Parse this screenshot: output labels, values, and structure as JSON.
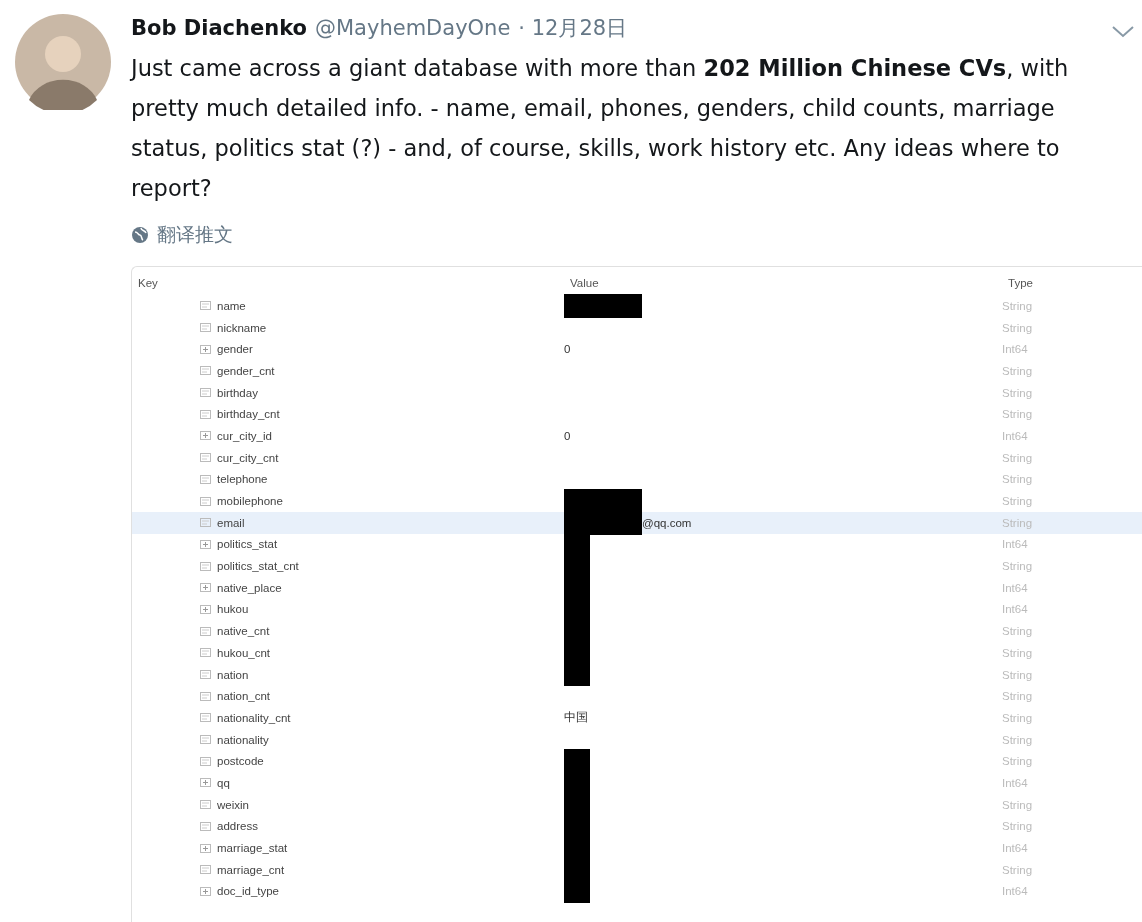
{
  "tweet": {
    "author": "Bob Diachenko",
    "handle": "@MayhemDayOne",
    "date": "· 12月28日",
    "text": "Just came across a giant database with more than **202 Million Chinese CVs**, with pretty much detailed info. - name, email, phones, genders, child counts, marriage status, politics stat (?) - and, of course, skills, work history etc. Any ideas where to report?",
    "translate": "翻译推文"
  },
  "table": {
    "columns": [
      "Key",
      "Value",
      "Type"
    ],
    "rows": [
      {
        "kind": "string",
        "key": "name",
        "value": "",
        "type": "String",
        "redacted": true,
        "wide_redaction": true,
        "selected": false
      },
      {
        "kind": "string",
        "key": "nickname",
        "value": "",
        "type": "String",
        "redacted": false,
        "selected": false
      },
      {
        "kind": "int",
        "key": "gender",
        "value": "0",
        "type": "Int64",
        "redacted": false,
        "selected": false
      },
      {
        "kind": "string",
        "key": "gender_cnt",
        "value": "",
        "type": "String",
        "redacted": false,
        "selected": false
      },
      {
        "kind": "string",
        "key": "birthday",
        "value": "",
        "type": "String",
        "redacted": false,
        "selected": false
      },
      {
        "kind": "string",
        "key": "birthday_cnt",
        "value": "",
        "type": "String",
        "redacted": false,
        "selected": false
      },
      {
        "kind": "int",
        "key": "cur_city_id",
        "value": "0",
        "type": "Int64",
        "redacted": false,
        "selected": false
      },
      {
        "kind": "string",
        "key": "cur_city_cnt",
        "value": "",
        "type": "String",
        "redacted": false,
        "selected": false
      },
      {
        "kind": "string",
        "key": "telephone",
        "value": "",
        "type": "String",
        "redacted": false,
        "selected": false
      },
      {
        "kind": "string",
        "key": "mobilephone",
        "value": "",
        "type": "String",
        "redacted": true,
        "wide_redaction": true,
        "selected": false
      },
      {
        "kind": "string",
        "key": "email",
        "value": "@qq.com",
        "type": "String",
        "redacted": true,
        "wide_redaction": true,
        "selected": true
      },
      {
        "kind": "int",
        "key": "politics_stat",
        "value": "",
        "type": "Int64",
        "redacted": true,
        "wide_redaction": false,
        "selected": false
      },
      {
        "kind": "string",
        "key": "politics_stat_cnt",
        "value": "",
        "type": "String",
        "redacted": true,
        "wide_redaction": false,
        "selected": false
      },
      {
        "kind": "int",
        "key": "native_place",
        "value": "",
        "type": "Int64",
        "redacted": true,
        "wide_redaction": false,
        "selected": false
      },
      {
        "kind": "int",
        "key": "hukou",
        "value": "",
        "type": "Int64",
        "redacted": true,
        "wide_redaction": false,
        "selected": false
      },
      {
        "kind": "string",
        "key": "native_cnt",
        "value": "",
        "type": "String",
        "redacted": true,
        "wide_redaction": false,
        "selected": false
      },
      {
        "kind": "string",
        "key": "hukou_cnt",
        "value": "",
        "type": "String",
        "redacted": true,
        "wide_redaction": false,
        "selected": false
      },
      {
        "kind": "string",
        "key": "nation",
        "value": "",
        "type": "String",
        "redacted": true,
        "wide_redaction": false,
        "selected": false
      },
      {
        "kind": "string",
        "key": "nation_cnt",
        "value": "",
        "type": "String",
        "redacted": false,
        "selected": false
      },
      {
        "kind": "string",
        "key": "nationality_cnt",
        "value": "中国",
        "type": "String",
        "redacted": false,
        "selected": false
      },
      {
        "kind": "string",
        "key": "nationality",
        "value": "",
        "type": "String",
        "redacted": false,
        "selected": false
      },
      {
        "kind": "string",
        "key": "postcode",
        "value": "",
        "type": "String",
        "redacted": true,
        "wide_redaction": false,
        "selected": false
      },
      {
        "kind": "int",
        "key": "qq",
        "value": "",
        "type": "Int64",
        "redacted": true,
        "wide_redaction": false,
        "selected": false
      },
      {
        "kind": "string",
        "key": "weixin",
        "value": "",
        "type": "String",
        "redacted": true,
        "wide_redaction": false,
        "selected": false
      },
      {
        "kind": "string",
        "key": "address",
        "value": "",
        "type": "String",
        "redacted": true,
        "wide_redaction": false,
        "selected": false
      },
      {
        "kind": "int",
        "key": "marriage_stat",
        "value": "",
        "type": "Int64",
        "redacted": true,
        "wide_redaction": false,
        "selected": false
      },
      {
        "kind": "string",
        "key": "marriage_cnt",
        "value": "",
        "type": "String",
        "redacted": true,
        "wide_redaction": false,
        "selected": false
      },
      {
        "kind": "int",
        "key": "doc_id_type",
        "value": "",
        "type": "Int64",
        "redacted": true,
        "wide_redaction": false,
        "selected": false
      }
    ]
  }
}
